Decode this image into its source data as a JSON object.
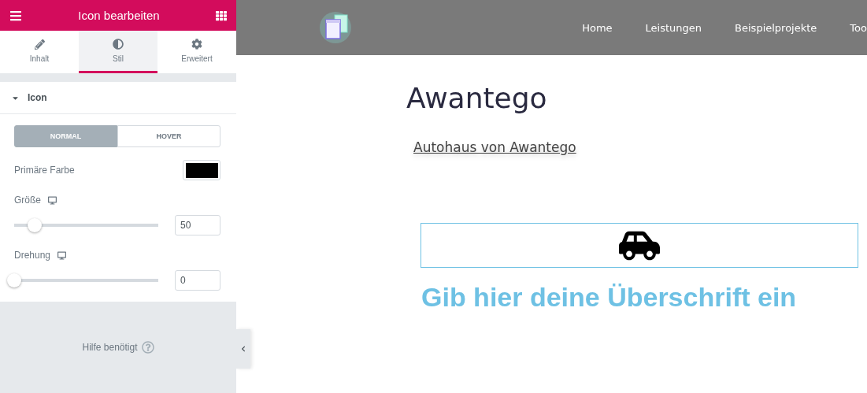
{
  "panel": {
    "title": "Icon bearbeiten",
    "tabs": [
      {
        "label": "Inhalt",
        "kind": "pencil",
        "selected": false
      },
      {
        "label": "Stil",
        "kind": "contrast",
        "selected": true
      },
      {
        "label": "Erweitert",
        "kind": "gear",
        "selected": false
      }
    ],
    "section": {
      "title": "Icon",
      "expanded": true
    },
    "state_toggle": [
      {
        "label": "NORMAL",
        "selected": true
      },
      {
        "label": "HOVER",
        "selected": false
      }
    ],
    "color_control": {
      "label": "Primäre Farbe",
      "color": "#000000"
    },
    "sliders": [
      {
        "label": "Größe",
        "level": 0.15,
        "value": "50"
      },
      {
        "label": "Drehung",
        "level": 0,
        "value": "0"
      }
    ],
    "help": "Hilfe benötigt"
  },
  "preview": {
    "nav": [
      "Home",
      "Leistungen",
      "Beispielprojekte",
      "Too"
    ],
    "title": "Awantego",
    "link": "Autohaus von Awantego",
    "heading": "Gib hier deine Überschrift ein"
  }
}
